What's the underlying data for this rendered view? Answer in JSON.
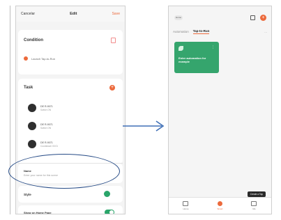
{
  "left": {
    "nav": {
      "cancel": "Cancelar",
      "title": "Edit",
      "save": "Save"
    },
    "condition": {
      "title": "Condition",
      "item": "Launch Tap-to-Run"
    },
    "task": {
      "title": "Task",
      "devices": [
        {
          "name": "DE R-9071",
          "sub": "Switch ON"
        },
        {
          "name": "DE R-9071",
          "sub": "Switch ON"
        },
        {
          "name": "DE R-9071",
          "sub": "Countdown 00:01"
        }
      ]
    },
    "name": {
      "label": "Name",
      "placeholder": "Enter your name for this scene"
    },
    "style": {
      "label": "Style"
    },
    "show": {
      "label": "Show on Home Page"
    }
  },
  "right": {
    "topbar": {
      "pill": "Home"
    },
    "tabs": [
      "Automation",
      "Tap-to-Run"
    ],
    "tab_more": "...",
    "scene": {
      "name": "Enter automation for example"
    },
    "toast": "Create a Tap",
    "bottom": [
      "Home",
      "Smart",
      "Me"
    ]
  },
  "colors": {
    "accent": "#ec6a3c",
    "green": "#35a56d",
    "ellipse": "#264b86",
    "arrow": "#3f6fb6"
  }
}
